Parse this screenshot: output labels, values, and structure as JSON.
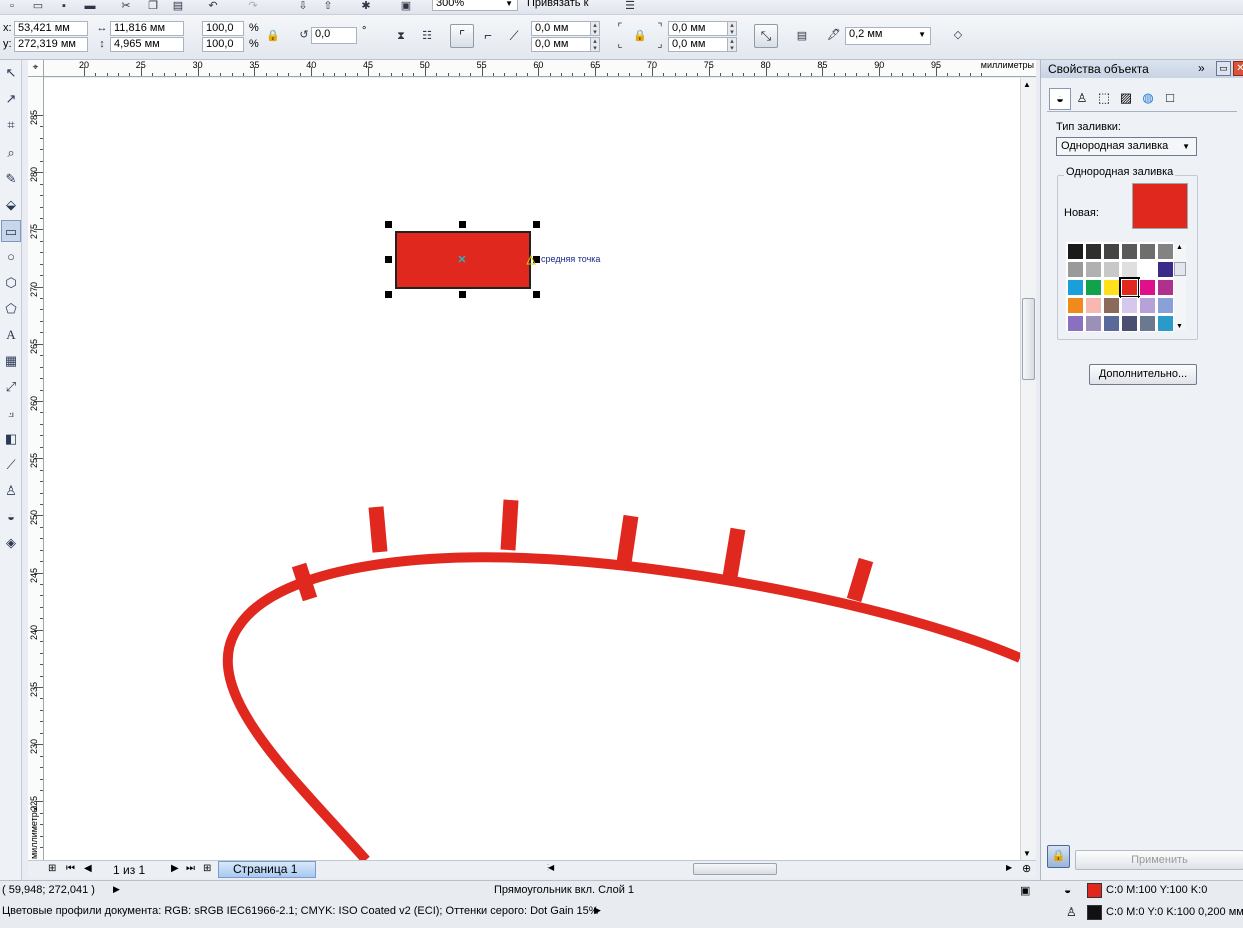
{
  "toolbar": {
    "zoom": "300%",
    "snap": "Привязать к",
    "x_label": "x:",
    "x_value": "53,421 мм",
    "y_label": "y:",
    "y_value": "272,319 мм",
    "w_value": "11,816 мм",
    "h_value": "4,965 мм",
    "scale_x": "100,0",
    "scale_y": "100,0",
    "percent": "%",
    "angle": "0,0",
    "degree": "°",
    "corner_1": "0,0 мм",
    "corner_2": "0,0 мм",
    "corner_3": "0,0 мм",
    "corner_4": "0,0 мм",
    "outline_width": "0,2 мм"
  },
  "ruler": {
    "h_numbers": [
      "20",
      "25",
      "30",
      "35",
      "40",
      "45",
      "50",
      "55",
      "60",
      "65",
      "70",
      "75",
      "80",
      "85",
      "90",
      "95"
    ],
    "h_unit": "миллиметры",
    "v_numbers": [
      "285",
      "280",
      "275",
      "270",
      "265",
      "260",
      "255",
      "250",
      "245",
      "240",
      "235",
      "230",
      "225"
    ],
    "v_unit": "миллиметры"
  },
  "canvas": {
    "snap_label": "средняя точка",
    "shape_fill": "#e0281e"
  },
  "docker": {
    "title": "Свойства объекта",
    "fill_type_label": "Тип заливки:",
    "fill_type_value": "Однородная заливка",
    "group_label": "Однородная заливка",
    "new_label": "Новая:",
    "new_color": "#e0281e",
    "more_button": "Дополнительно...",
    "apply_button": "Применить",
    "palette": [
      "#1a1a1a",
      "#2e2e2e",
      "#444444",
      "#5a5a5a",
      "#6e6e6e",
      "#838383",
      "#9a9a9a",
      "#b1b1b1",
      "#c8c8c8",
      "#dfdfdf",
      "#ffffff",
      "#3a2a8a",
      "#1aa0d8",
      "#11a34a",
      "#ffe01a",
      "#e0281e",
      "#e0108a",
      "#b03090",
      "#f08a1a",
      "#f6b8b0",
      "#8a6a5a",
      "#d6c8ec",
      "#b8a0d8",
      "#8aa0d8",
      "#8a70c0",
      "#9a90b8",
      "#5a6a98",
      "#4a5070",
      "#6a7890",
      "#2a9ac8"
    ]
  },
  "pagebar": {
    "page_count": "1 из 1",
    "page_tab": "Страница 1"
  },
  "status": {
    "coords": "( 59,948; 272,041 )",
    "selection": "Прямоугольник вкл. Слой 1",
    "profiles": "Цветовые профили документа: RGB: sRGB IEC61966-2.1; CMYK: ISO Coated v2 (ECI); Оттенки серого: Dot Gain 15%",
    "fill_info": "C:0 M:100 Y:100 K:0",
    "fill_color": "#e0281e",
    "outline_info": "C:0 M:0 Y:0 K:100  0,200 мм",
    "outline_color": "#111111"
  }
}
